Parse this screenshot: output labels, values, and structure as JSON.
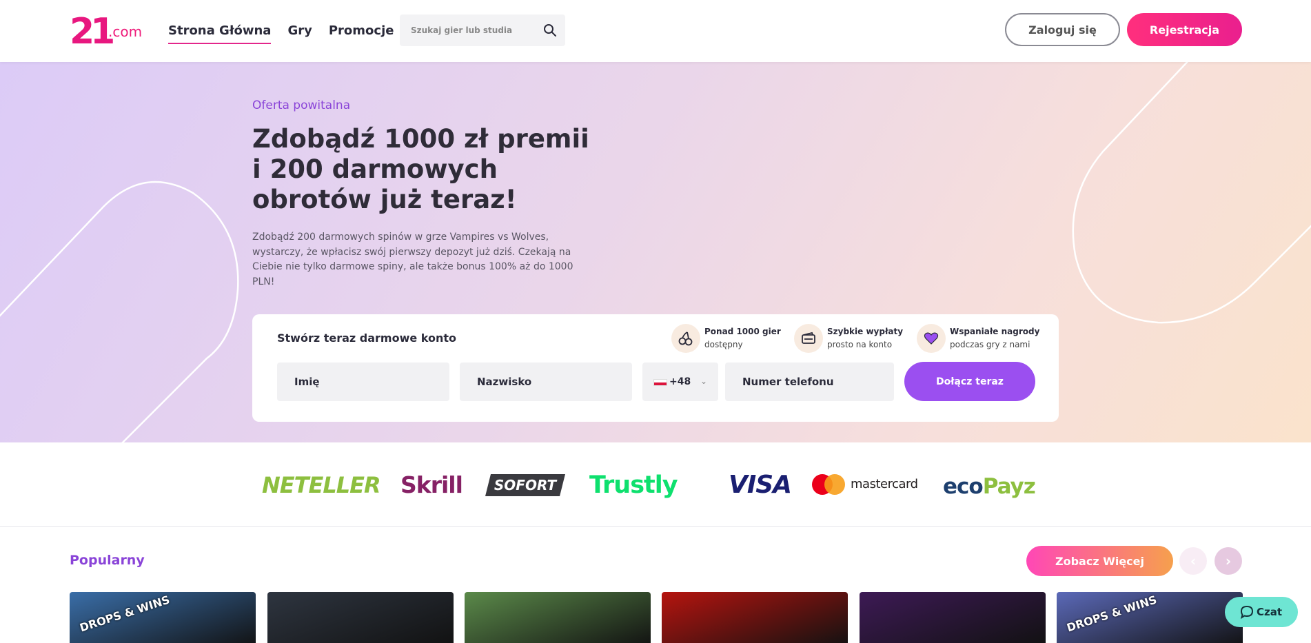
{
  "header": {
    "logo_main": "21",
    "logo_suffix": ".com",
    "nav": [
      {
        "label": "Strona Główna",
        "active": true
      },
      {
        "label": "Gry",
        "active": false
      },
      {
        "label": "Promocje",
        "active": false
      }
    ],
    "search_placeholder": "Szukaj gier lub studia",
    "search_icon": "search-icon",
    "login_label": "Zaloguj się",
    "register_label": "Rejestracja"
  },
  "hero": {
    "eyebrow": "Oferta powitalna",
    "title": "Zdobądź 1000 zł premii i 200 darmowych obrotów już teraz!",
    "description": "Zdobądź 200 darmowych spinów w grze Vampires vs Wolves, wystarczy, że wpłacisz swój pierwszy depozyt już dziś. Czekają na Ciebie nie tylko darmowe spiny, ale także bonus 100% aż do 1000 PLN!"
  },
  "signup": {
    "title": "Stwórz teraz darmowe konto",
    "features": [
      {
        "icon": "cherries-icon",
        "line1": "Ponad 1000 gier",
        "line2": "dostępny"
      },
      {
        "icon": "wallet-icon",
        "line1": "Szybkie wypłaty",
        "line2": "prosto na konto"
      },
      {
        "icon": "heart-icon",
        "line1": "Wspaniałe nagrody",
        "line2": "podczas gry z nami"
      }
    ],
    "first_name_placeholder": "Imię",
    "last_name_placeholder": "Nazwisko",
    "country_code": "+48",
    "phone_placeholder": "Numer telefonu",
    "join_label": "Dołącz teraz"
  },
  "payments": {
    "neteller": "NETELLER",
    "skrill": "Skrill",
    "sofort": "SOFORT",
    "trustly": "Trustly",
    "visa": "VISA",
    "mastercard": "mastercard",
    "ecopayz_a": "eco",
    "ecopayz_b": "Payz"
  },
  "popular": {
    "title": "Popularny",
    "more_label": "Zobacz Więcej",
    "prev_icon": "chevron-left-icon",
    "next_icon": "chevron-right-icon",
    "tiles": [
      {
        "badge": "DROPS & WINS",
        "bg": "#3a6ea8"
      },
      {
        "badge": "",
        "bg": "#2e3540"
      },
      {
        "badge": "",
        "bg": "#5b8a4a"
      },
      {
        "badge": "",
        "bg": "#b5140f"
      },
      {
        "badge": "",
        "bg": "#3d1a55"
      },
      {
        "badge": "DROPS & WINS",
        "bg": "#5b69b8"
      }
    ]
  },
  "chat": {
    "label": "Czat",
    "icon": "chat-bubble-icon"
  },
  "colors": {
    "brand_pink": "#ea1f8e",
    "accent_purple": "#9b4ff0",
    "chat_teal": "#6ee5d3"
  }
}
